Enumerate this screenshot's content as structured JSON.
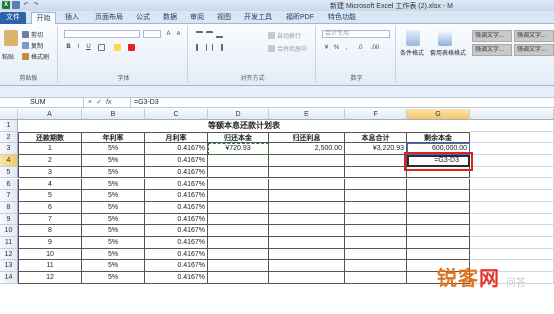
{
  "app": {
    "title": "新建 Microsoft Excel 工作表 (2).xlsx - M"
  },
  "ribbon": {
    "tabs": [
      {
        "label": "文件"
      },
      {
        "label": "开始"
      },
      {
        "label": "插入"
      },
      {
        "label": "页面布局"
      },
      {
        "label": "公式"
      },
      {
        "label": "数据"
      },
      {
        "label": "审阅"
      },
      {
        "label": "视图"
      },
      {
        "label": "开发工具"
      },
      {
        "label": "福昕PDF"
      },
      {
        "label": "特色功能"
      }
    ],
    "clipboard": {
      "cut": "剪切",
      "copy": "复制",
      "paste": "粘贴",
      "format_painter": "格式刷",
      "label": "剪贴板"
    },
    "font": {
      "label": "字体",
      "bold": "B",
      "italic": "I",
      "underline": "U",
      "grow": "A",
      "shrink": "A"
    },
    "alignment": {
      "label": "对齐方式",
      "wrap": "自动换行",
      "merge": "合并后居中"
    },
    "number": {
      "label": "数字",
      "format": "会计专用",
      "percent": "%",
      "comma": ",",
      "inc_dec": ".0",
      "dec_dec": ".00"
    },
    "styles": {
      "conditional": "条件格式",
      "table": "套用表格格式",
      "style1": "强调文字...",
      "style2": "强调文字...",
      "style3": "强调文字...",
      "style4": "强调文字..."
    }
  },
  "formula_bar": {
    "name_box": "SUM",
    "cancel": "×",
    "enter": "✓",
    "fx": "fx",
    "formula": "=G3-D3"
  },
  "sheet": {
    "columns": [
      "A",
      "B",
      "C",
      "D",
      "E",
      "F",
      "G"
    ],
    "rows": [
      "1",
      "2",
      "3",
      "4",
      "5",
      "6",
      "7",
      "8",
      "9",
      "10",
      "11",
      "12",
      "13",
      "14"
    ],
    "title": "等额本息还款计划表",
    "headers": [
      "还款期数",
      "年利率",
      "月利率",
      "归还本金",
      "归还利息",
      "本息合计",
      "剩余本金"
    ],
    "data": [
      [
        "1",
        "5%",
        "0.4167%",
        "¥720.93",
        "2,500.00",
        "¥3,220.93",
        "600,000.00"
      ],
      [
        "2",
        "5%",
        "0.4167%",
        "",
        "",
        "",
        "=G3-D3"
      ],
      [
        "3",
        "5%",
        "0.4167%",
        "",
        "",
        "",
        ""
      ],
      [
        "4",
        "5%",
        "0.4167%",
        "",
        "",
        "",
        ""
      ],
      [
        "5",
        "5%",
        "0.4167%",
        "",
        "",
        "",
        ""
      ],
      [
        "6",
        "5%",
        "0.4167%",
        "",
        "",
        "",
        ""
      ],
      [
        "7",
        "5%",
        "0.4167%",
        "",
        "",
        "",
        ""
      ],
      [
        "8",
        "5%",
        "0.4167%",
        "",
        "",
        "",
        ""
      ],
      [
        "9",
        "5%",
        "0.4167%",
        "",
        "",
        "",
        ""
      ],
      [
        "10",
        "5%",
        "0.4167%",
        "",
        "",
        "",
        ""
      ],
      [
        "11",
        "5%",
        "0.4167%",
        "",
        "",
        "",
        ""
      ],
      [
        "12",
        "5%",
        "0.4167%",
        "",
        "",
        "",
        ""
      ]
    ]
  },
  "watermark": {
    "brand_a": "锐客",
    "brand_b": "网",
    "suffix": "问答"
  },
  "colors": {
    "file_tab": "#2c62a8",
    "active_header": "#f4c766",
    "highlight_box": "#e02020",
    "copy_border": "#2e7d32"
  }
}
